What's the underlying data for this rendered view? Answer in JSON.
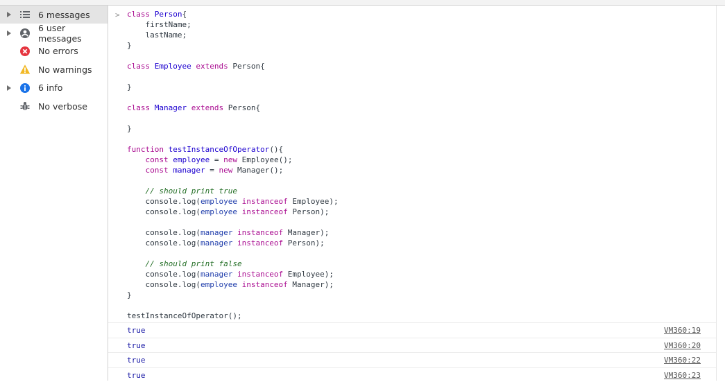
{
  "sidebar": {
    "items": [
      {
        "label": "6 messages",
        "icon": "list-icon",
        "expandable": true,
        "selected": true
      },
      {
        "label": "6 user messages",
        "icon": "user-icon",
        "expandable": true,
        "selected": false
      },
      {
        "label": "No errors",
        "icon": "error-icon",
        "expandable": false,
        "selected": false
      },
      {
        "label": "No warnings",
        "icon": "warning-icon",
        "expandable": false,
        "selected": false
      },
      {
        "label": "6 info",
        "icon": "info-icon",
        "expandable": true,
        "selected": false
      },
      {
        "label": "No verbose",
        "icon": "bug-icon",
        "expandable": false,
        "selected": false
      }
    ]
  },
  "colors": {
    "error": "#e5353f",
    "warning": "#f2b824",
    "info": "#1a73e8",
    "keyword": "#aa0d91",
    "definition": "#1c00cf",
    "variable": "#1f3dab",
    "comment": "#236e25",
    "log_value": "#1a1aa6"
  },
  "console": {
    "prompt_symbol": ">",
    "code_lines": [
      [
        {
          "t": "class",
          "c": "kw"
        },
        {
          "t": " "
        },
        {
          "t": "Person",
          "c": "def"
        },
        {
          "t": "{"
        }
      ],
      [
        {
          "t": "    firstName;"
        }
      ],
      [
        {
          "t": "    lastName;"
        }
      ],
      [
        {
          "t": "}"
        }
      ],
      [
        {
          "t": ""
        }
      ],
      [
        {
          "t": "class",
          "c": "kw"
        },
        {
          "t": " "
        },
        {
          "t": "Employee",
          "c": "def"
        },
        {
          "t": " "
        },
        {
          "t": "extends",
          "c": "kw"
        },
        {
          "t": " Person{"
        }
      ],
      [
        {
          "t": ""
        }
      ],
      [
        {
          "t": "}"
        }
      ],
      [
        {
          "t": ""
        }
      ],
      [
        {
          "t": "class",
          "c": "kw"
        },
        {
          "t": " "
        },
        {
          "t": "Manager",
          "c": "def"
        },
        {
          "t": " "
        },
        {
          "t": "extends",
          "c": "kw"
        },
        {
          "t": " Person{"
        }
      ],
      [
        {
          "t": ""
        }
      ],
      [
        {
          "t": "}"
        }
      ],
      [
        {
          "t": ""
        }
      ],
      [
        {
          "t": "function",
          "c": "kw"
        },
        {
          "t": " "
        },
        {
          "t": "testInstanceOfOperator",
          "c": "def"
        },
        {
          "t": "(){"
        }
      ],
      [
        {
          "t": "    "
        },
        {
          "t": "const",
          "c": "kw"
        },
        {
          "t": " "
        },
        {
          "t": "employee",
          "c": "def"
        },
        {
          "t": " = "
        },
        {
          "t": "new",
          "c": "kw"
        },
        {
          "t": " Employee();"
        }
      ],
      [
        {
          "t": "    "
        },
        {
          "t": "const",
          "c": "kw"
        },
        {
          "t": " "
        },
        {
          "t": "manager",
          "c": "def"
        },
        {
          "t": " = "
        },
        {
          "t": "new",
          "c": "kw"
        },
        {
          "t": " Manager();"
        }
      ],
      [
        {
          "t": ""
        }
      ],
      [
        {
          "t": "    "
        },
        {
          "t": "// should print true",
          "c": "cmt"
        }
      ],
      [
        {
          "t": "    console.log("
        },
        {
          "t": "employee",
          "c": "var"
        },
        {
          "t": " "
        },
        {
          "t": "instanceof",
          "c": "kw"
        },
        {
          "t": " Employee);"
        }
      ],
      [
        {
          "t": "    console.log("
        },
        {
          "t": "employee",
          "c": "var"
        },
        {
          "t": " "
        },
        {
          "t": "instanceof",
          "c": "kw"
        },
        {
          "t": " Person);"
        }
      ],
      [
        {
          "t": ""
        }
      ],
      [
        {
          "t": "    console.log("
        },
        {
          "t": "manager",
          "c": "var"
        },
        {
          "t": " "
        },
        {
          "t": "instanceof",
          "c": "kw"
        },
        {
          "t": " Manager);"
        }
      ],
      [
        {
          "t": "    console.log("
        },
        {
          "t": "manager",
          "c": "var"
        },
        {
          "t": " "
        },
        {
          "t": "instanceof",
          "c": "kw"
        },
        {
          "t": " Person);"
        }
      ],
      [
        {
          "t": ""
        }
      ],
      [
        {
          "t": "    "
        },
        {
          "t": "// should print false",
          "c": "cmt"
        }
      ],
      [
        {
          "t": "    console.log("
        },
        {
          "t": "manager",
          "c": "var"
        },
        {
          "t": " "
        },
        {
          "t": "instanceof",
          "c": "kw"
        },
        {
          "t": " Employee);"
        }
      ],
      [
        {
          "t": "    console.log("
        },
        {
          "t": "employee",
          "c": "var"
        },
        {
          "t": " "
        },
        {
          "t": "instanceof",
          "c": "kw"
        },
        {
          "t": " Manager);"
        }
      ],
      [
        {
          "t": "}"
        }
      ],
      [
        {
          "t": ""
        }
      ],
      [
        {
          "t": "testInstanceOfOperator();"
        }
      ]
    ],
    "logs": [
      {
        "value": "true",
        "source": "VM360:19"
      },
      {
        "value": "true",
        "source": "VM360:20"
      },
      {
        "value": "true",
        "source": "VM360:22"
      },
      {
        "value": "true",
        "source": "VM360:23"
      }
    ]
  }
}
